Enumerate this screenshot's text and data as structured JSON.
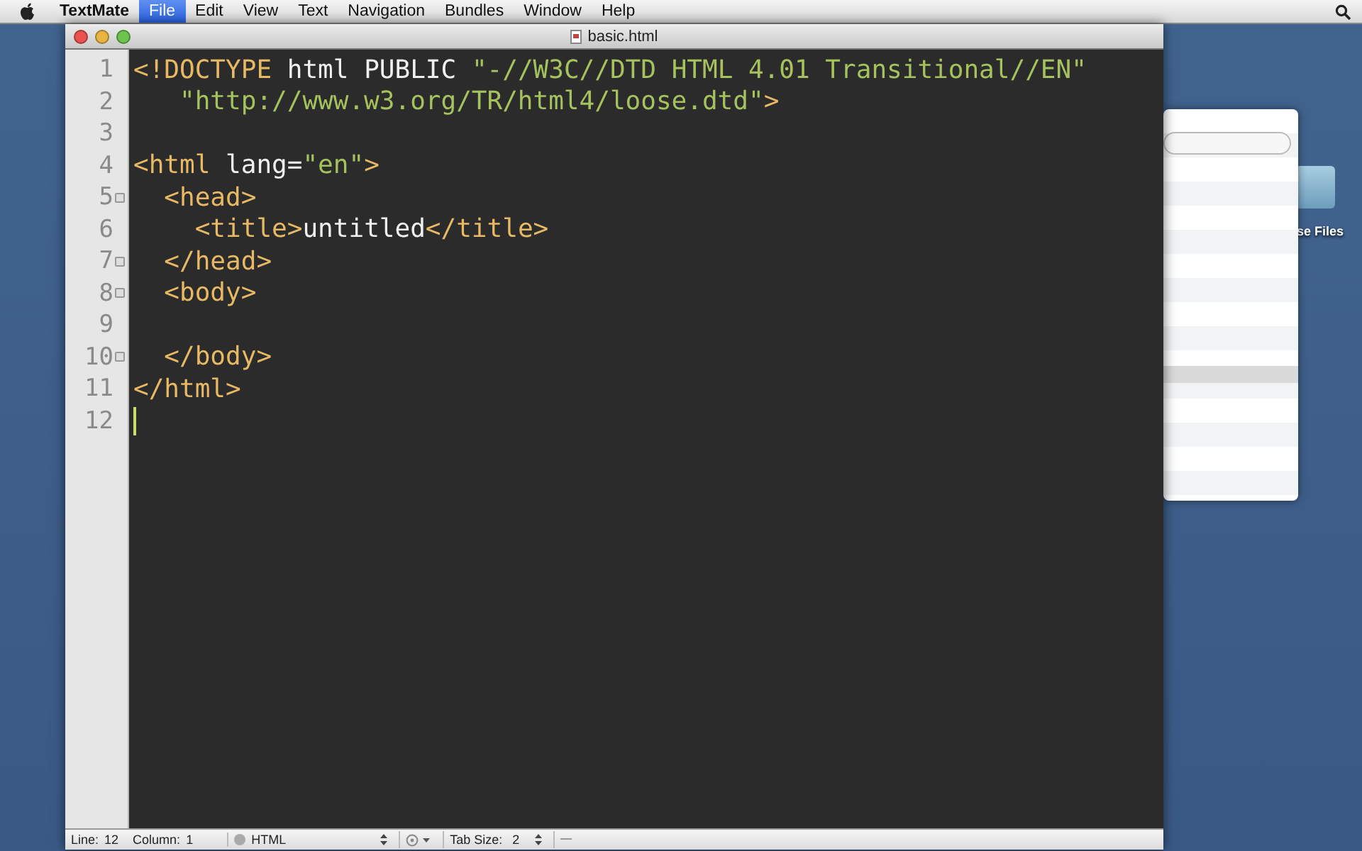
{
  "menu_bar": {
    "app": "TextMate",
    "items": [
      {
        "label": "File",
        "selected": true
      },
      {
        "label": "Edit",
        "selected": false
      },
      {
        "label": "View",
        "selected": false
      },
      {
        "label": "Text",
        "selected": false
      },
      {
        "label": "Navigation",
        "selected": false
      },
      {
        "label": "Bundles",
        "selected": false
      },
      {
        "label": "Window",
        "selected": false
      },
      {
        "label": "Help",
        "selected": false
      }
    ]
  },
  "window": {
    "title": "basic.html"
  },
  "editor": {
    "lines": [
      {
        "number": "1",
        "fold": false,
        "cursor": false,
        "tokens": [
          {
            "kind": "tag",
            "text": "<!DOCTYPE"
          },
          {
            "kind": "plain",
            "text": " html PUBLIC "
          },
          {
            "kind": "string",
            "text": "\"-//W3C//DTD HTML 4.01 Transitional//EN\""
          }
        ]
      },
      {
        "number": "2",
        "fold": false,
        "cursor": false,
        "tokens": [
          {
            "kind": "string",
            "text": "   \"http://www.w3.org/TR/html4/loose.dtd\""
          },
          {
            "kind": "tag",
            "text": ">"
          }
        ]
      },
      {
        "number": "3",
        "fold": false,
        "cursor": false
      },
      {
        "number": "4",
        "fold": false,
        "cursor": false,
        "tokens": [
          {
            "kind": "tag",
            "text": "<html"
          },
          {
            "kind": "plain",
            "text": " lang="
          },
          {
            "kind": "string",
            "text": "\"en\""
          },
          {
            "kind": "tag",
            "text": ">"
          }
        ]
      },
      {
        "number": "5",
        "fold": true,
        "cursor": false,
        "tokens": [
          {
            "kind": "tag",
            "text": "  <head>"
          }
        ]
      },
      {
        "number": "6",
        "fold": false,
        "cursor": false,
        "tokens": [
          {
            "kind": "tag",
            "text": "    <title>"
          },
          {
            "kind": "plain",
            "text": "untitled"
          },
          {
            "kind": "tag",
            "text": "</title>"
          }
        ]
      },
      {
        "number": "7",
        "fold": true,
        "cursor": false,
        "tokens": [
          {
            "kind": "tag",
            "text": "  </head>"
          }
        ]
      },
      {
        "number": "8",
        "fold": true,
        "cursor": false,
        "tokens": [
          {
            "kind": "tag",
            "text": "  <body>"
          }
        ]
      },
      {
        "number": "9",
        "fold": false,
        "cursor": false
      },
      {
        "number": "10",
        "fold": true,
        "cursor": false,
        "tokens": [
          {
            "kind": "tag",
            "text": "  </body>"
          }
        ]
      },
      {
        "number": "11",
        "fold": false,
        "cursor": false,
        "tokens": [
          {
            "kind": "tag",
            "text": "</html>"
          }
        ]
      },
      {
        "number": "12",
        "fold": false,
        "cursor": true
      }
    ]
  },
  "status_bar": {
    "line_label": "Line:",
    "line": "12",
    "column_label": "Column:",
    "column": "1",
    "language": "HTML",
    "tab_size_label": "Tab Size:",
    "tab_size": "2"
  },
  "desktop": {
    "icon_label": "se Files"
  }
}
